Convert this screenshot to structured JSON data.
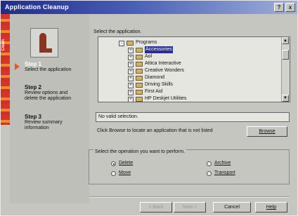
{
  "window": {
    "title": "Application Cleanup"
  },
  "titlebar_buttons": {
    "help": "?",
    "close": "x"
  },
  "stripe_label": "Clean",
  "steps": [
    {
      "heading": "Step 1",
      "desc1": "Select the application",
      "desc2": ""
    },
    {
      "heading": "Step 2",
      "desc1": "Review options and",
      "desc2": "delete the application"
    },
    {
      "heading": "Step 3",
      "desc1": "Review summary",
      "desc2": "information"
    }
  ],
  "main": {
    "select_label": "Select the application.",
    "tree": [
      {
        "label": "Programs",
        "expander": "-"
      },
      {
        "label": "Accessories",
        "expander": "+"
      },
      {
        "label": "Aol",
        "expander": "+"
      },
      {
        "label": "Attica Interactive",
        "expander": "+"
      },
      {
        "label": "Creative Wonders",
        "expander": "+"
      },
      {
        "label": "Diamond",
        "expander": "+"
      },
      {
        "label": "Driving Skills",
        "expander": "+"
      },
      {
        "label": "First Aid",
        "expander": "+"
      },
      {
        "label": "HP Deskjet Utilities",
        "expander": "+"
      }
    ],
    "status_text": "No valid selection.",
    "browse_hint": "Click Browse to locate an application that is not listed",
    "browse_button": "Browse",
    "operation_label": "Select the operation you want to perform.",
    "operations": {
      "delete": "Delete",
      "archive": "Archive",
      "move": "Move",
      "transport": "Transport"
    },
    "selected_operation": "delete"
  },
  "footer": {
    "back": "< Back",
    "next": "Next >",
    "cancel": "Cancel",
    "help": "Help"
  }
}
